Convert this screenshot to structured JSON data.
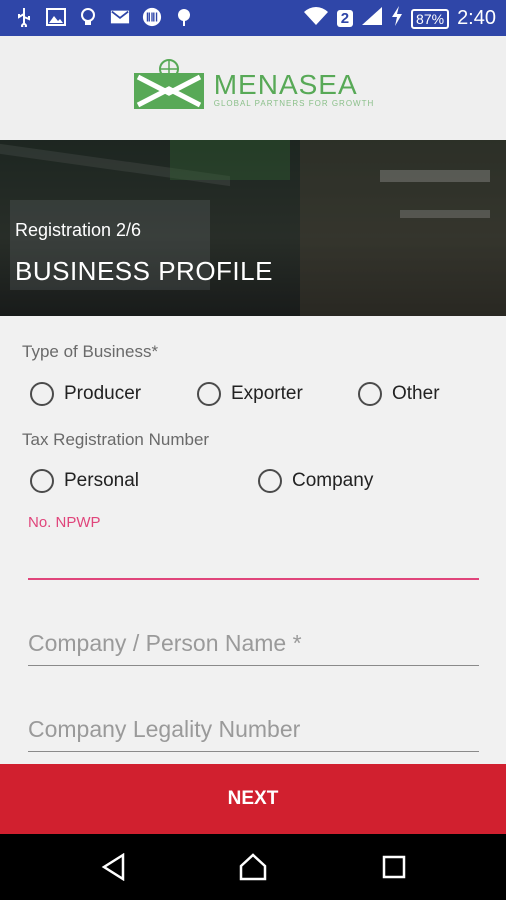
{
  "status_bar": {
    "time": "2:40",
    "battery": "87%",
    "sim_badge": "2",
    "left_icons": [
      "usb-icon",
      "image-icon",
      "lightbulb-icon",
      "gmail-icon",
      "barcode-icon",
      "android-icon"
    ]
  },
  "brand": {
    "name": "MENASEA",
    "tagline": "GLOBAL PARTNERS FOR GROWTH",
    "color": "#58a957"
  },
  "hero": {
    "step": "Registration 2/6",
    "title": "BUSINESS PROFILE"
  },
  "form": {
    "business_type": {
      "label": "Type of Business*",
      "options": [
        "Producer",
        "Exporter",
        "Other"
      ]
    },
    "tax_registration": {
      "label": "Tax Registration Number",
      "options": [
        "Personal",
        "Company"
      ]
    },
    "npwp": {
      "label": "No. NPWP",
      "value": ""
    },
    "company_name": {
      "placeholder": "Company / Person Name *"
    },
    "legality_number": {
      "placeholder": "Company Legality Number"
    }
  },
  "next_button": {
    "label": "NEXT",
    "color": "#d1202f"
  },
  "accent_color": "#e0457b",
  "status_bar_color": "#2f46a8"
}
